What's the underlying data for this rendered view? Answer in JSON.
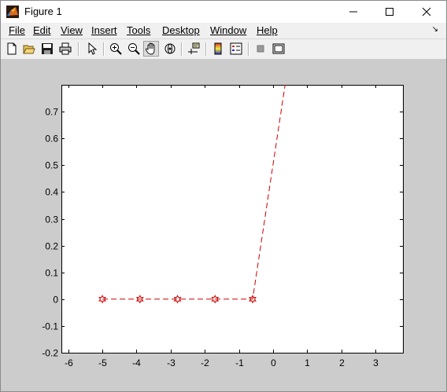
{
  "window": {
    "title": "Figure 1",
    "app_icon": "matlab-icon",
    "controls": [
      "minimize-icon",
      "maximize-icon",
      "close-icon"
    ]
  },
  "menubar": {
    "items": [
      {
        "label": "File"
      },
      {
        "label": "Edit"
      },
      {
        "label": "View"
      },
      {
        "label": "Insert"
      },
      {
        "label": "Tools"
      },
      {
        "label": "Desktop"
      },
      {
        "label": "Window"
      },
      {
        "label": "Help"
      }
    ],
    "overflow_icon": "dock-arrow-icon"
  },
  "toolbar": {
    "tools": [
      "new-figure-icon",
      "open-file-icon",
      "save-icon",
      "print-icon",
      "edit-plot-pointer-icon",
      "zoom-in-icon",
      "zoom-out-icon",
      "pan-hand-icon",
      "rotate-3d-icon",
      "data-cursor-icon",
      "colorbar-icon",
      "legend-icon",
      "hide-plot-tools-icon",
      "show-plot-tools-icon"
    ],
    "active_tool": "pan-hand-icon"
  },
  "colors": {
    "figure_bg": "#cccccc",
    "axes_bg": "#ffffff",
    "series": "#cc0000"
  },
  "chart_data": {
    "type": "line",
    "title": "",
    "xlabel": "",
    "ylabel": "",
    "xlim": [
      -6.2,
      3.8
    ],
    "ylim": [
      -0.2,
      0.8
    ],
    "xticks": [
      -6,
      -5,
      -4,
      -3,
      -2,
      -1,
      0,
      1,
      2,
      3
    ],
    "xtick_labels": [
      "-6",
      "-5",
      "-4",
      "-3",
      "-2",
      "-1",
      "0",
      "1",
      "2",
      "3"
    ],
    "yticks": [
      -0.2,
      -0.1,
      0,
      0.1,
      0.2,
      0.3,
      0.4,
      0.5,
      0.6,
      0.7
    ],
    "ytick_labels": [
      "-0.2",
      "-0.1",
      "0",
      "0.1",
      "0.2",
      "0.3",
      "0.4",
      "0.5",
      "0.6",
      "0.7"
    ],
    "grid": false,
    "legend": false,
    "series": [
      {
        "line_style": "dashed",
        "marker": "hexagram",
        "color": "#cc0000",
        "x": [
          -5.0,
          -3.9,
          -2.8,
          -1.7,
          -0.6,
          0.35
        ],
        "y": [
          0,
          0,
          0,
          0,
          0,
          0.8
        ],
        "marker_x": [
          -5.0,
          -3.9,
          -2.8,
          -1.7,
          -0.6
        ],
        "marker_y": [
          0,
          0,
          0,
          0,
          0
        ]
      }
    ]
  }
}
